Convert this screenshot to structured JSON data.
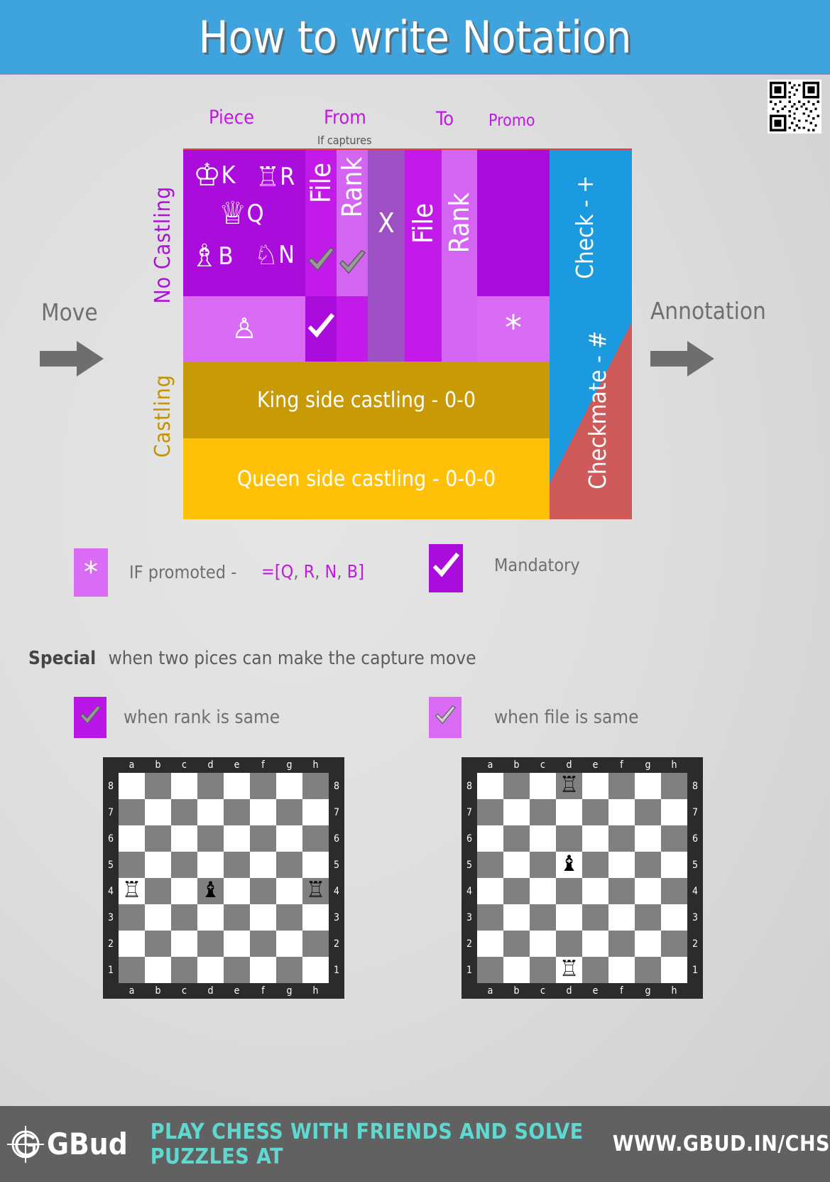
{
  "header": {
    "title": "How to write Notation"
  },
  "captions": {
    "piece": "Piece",
    "from": "From",
    "to": "To",
    "promo": "Promo",
    "if_captures": "If captures"
  },
  "sides": {
    "move": "Move",
    "annotation": "Annotation",
    "no_castling": "No Castling",
    "castling": "Castling"
  },
  "table": {
    "pieces": [
      {
        "glyph": "♔",
        "letter": "K"
      },
      {
        "glyph": "♖",
        "letter": "R"
      },
      {
        "glyph": "♕",
        "letter": "Q"
      },
      {
        "glyph": "♗",
        "letter": "B"
      },
      {
        "glyph": "♘",
        "letter": "N"
      }
    ],
    "pawn_glyph": "♙",
    "col_from_file": "File",
    "col_from_rank": "Rank",
    "col_capture": "X",
    "col_to_file": "File",
    "col_to_rank": "Rank",
    "promo_star": "*",
    "king_side_castling": "King side castling - 0-0",
    "queen_side_castling": "Queen side castling - 0-0-0",
    "check": "Check - +",
    "checkmate": "Checkmate - #"
  },
  "legend": {
    "star": "*",
    "promoted_label": "IF promoted -",
    "promoted_prefix": "=[",
    "promoted_options": [
      "Q",
      "R",
      "N",
      "B"
    ],
    "promoted_suffix": "]",
    "mandatory": "Mandatory"
  },
  "special": {
    "title": "Special",
    "subtitle": "when two pices can make the capture move",
    "rank_label": "when rank is same",
    "file_label": "when file is same"
  },
  "boards": {
    "files": [
      "a",
      "b",
      "c",
      "d",
      "e",
      "f",
      "g",
      "h"
    ],
    "ranks": [
      "8",
      "7",
      "6",
      "5",
      "4",
      "3",
      "2",
      "1"
    ],
    "left": {
      "pieces": [
        {
          "square": "a4",
          "glyph": "♖"
        },
        {
          "square": "d4",
          "glyph": "♝"
        },
        {
          "square": "h4",
          "glyph": "♖"
        }
      ]
    },
    "right": {
      "pieces": [
        {
          "square": "d8",
          "glyph": "♖"
        },
        {
          "square": "d5",
          "glyph": "♝"
        },
        {
          "square": "d1",
          "glyph": "♖"
        }
      ]
    }
  },
  "footer": {
    "logo_text": "GBud",
    "tagline": "PLAY CHESS WITH FRIENDS AND SOLVE PUZZLES AT",
    "url": "WWW.GBUD.IN/CHS"
  },
  "colors": {
    "header_blue": "#3fa3dd",
    "purple_dark": "#aa0ddb",
    "purple_mid": "#b916e8",
    "purple_light": "#d96bf5",
    "purple_muted": "#9d4fc4",
    "magenta_text": "#c01ae0",
    "gold_dark": "#c79a06",
    "gold": "#ffc107",
    "check_blue": "#1b9ae0",
    "mate_red": "#cf5a5a",
    "footer_gray": "#616161",
    "teal": "#5fd8cf"
  }
}
